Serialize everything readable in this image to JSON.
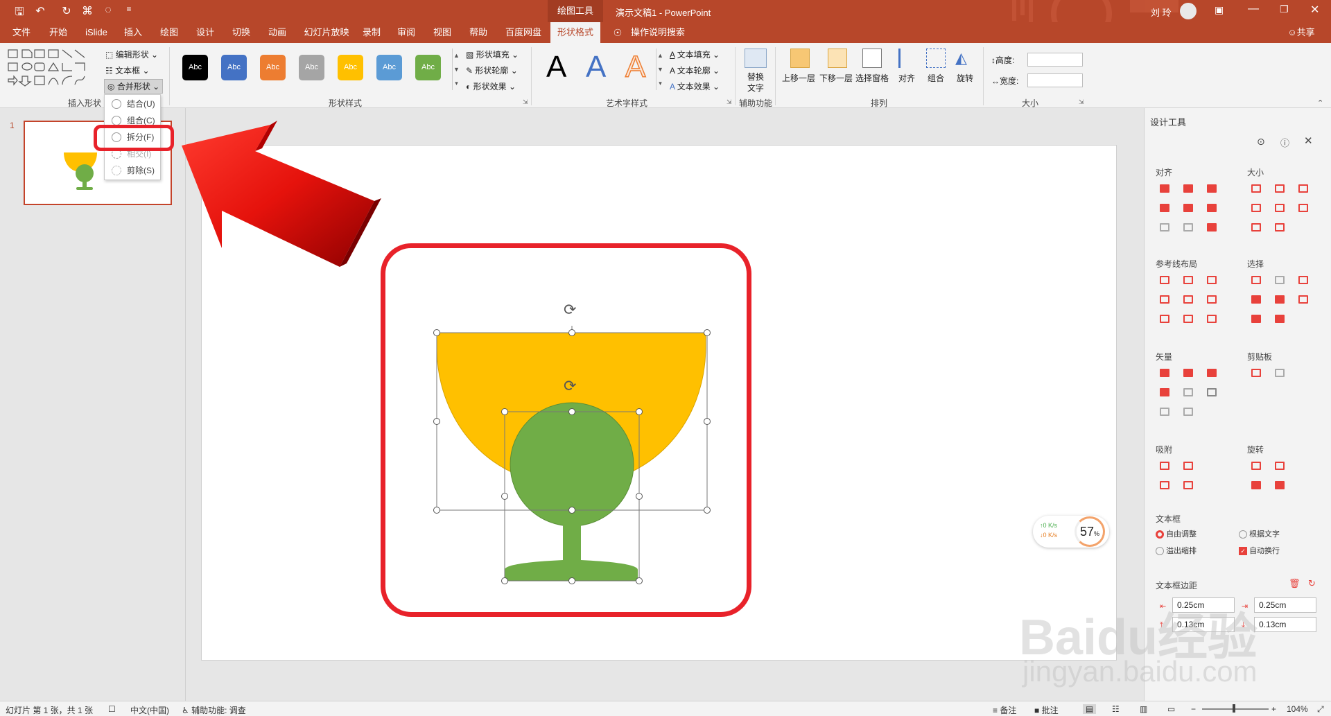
{
  "title_bar": {
    "context_tool": "绘图工具",
    "doc_title": "演示文稿1  -  PowerPoint",
    "user_name": "刘 玲",
    "quick_access": [
      "save-icon",
      "undo-icon",
      "redo-icon",
      "format-painter-icon",
      "shapes-icon",
      "customize-icon"
    ]
  },
  "tabs": [
    "文件",
    "开始",
    "iSlide",
    "插入",
    "绘图",
    "设计",
    "切换",
    "动画",
    "幻灯片放映",
    "录制",
    "审阅",
    "视图",
    "帮助",
    "百度网盘",
    "形状格式"
  ],
  "active_tab": "形状格式",
  "tell_me": "操作说明搜索",
  "share": "共享",
  "ribbon": {
    "insert_shapes": {
      "edit_shape": "编辑形状",
      "text_box": "文本框",
      "merge_shapes": "合并形状",
      "label": "插入形状"
    },
    "shape_styles": {
      "swatches": [
        {
          "text": "Abc",
          "color": "#000000"
        },
        {
          "text": "Abc",
          "color": "#4472c4"
        },
        {
          "text": "Abc",
          "color": "#ed7d31"
        },
        {
          "text": "Abc",
          "color": "#a5a5a5"
        },
        {
          "text": "Abc",
          "color": "#ffc000"
        },
        {
          "text": "Abc",
          "color": "#5b9bd5"
        },
        {
          "text": "Abc",
          "color": "#70ad47"
        }
      ],
      "fill": "形状填充",
      "outline": "形状轮廓",
      "effects": "形状效果",
      "label": "形状样式"
    },
    "wordart": {
      "letters": [
        "A",
        "A",
        "A"
      ],
      "text_fill": "文本填充",
      "text_outline": "文本轮廓",
      "text_effects": "文本效果",
      "label": "艺术字样式"
    },
    "accessibility": {
      "alt_text_l1": "替换",
      "alt_text_l2": "文字",
      "label": "辅助功能"
    },
    "arrange": {
      "bring_forward": "上移一层",
      "send_backward": "下移一层",
      "selection_pane": "选择窗格",
      "align": "对齐",
      "group": "组合",
      "rotate": "旋转",
      "label": "排列"
    },
    "size": {
      "height_label": "高度:",
      "width_label": "宽度:",
      "height_value": "",
      "width_value": "",
      "label": "大小"
    }
  },
  "merge_menu": [
    {
      "label": "结合(U)",
      "disabled": false
    },
    {
      "label": "组合(C)",
      "disabled": false
    },
    {
      "label": "拆分(F)",
      "disabled": false
    },
    {
      "label": "相交(I)",
      "disabled": true
    },
    {
      "label": "剪除(S)",
      "disabled": false
    }
  ],
  "thumbnail": {
    "number": "1"
  },
  "net_widget": {
    "up": "0  K/s",
    "down": "0  K/s",
    "percent": "57",
    "unit": "%"
  },
  "design_pane": {
    "title": "设计工具",
    "sections": {
      "align": "对齐",
      "size": "大小",
      "guides": "参考线布局",
      "select": "选择",
      "vector": "矢量",
      "clipboard": "剪贴板",
      "snap": "吸附",
      "rotate": "旋转",
      "textbox": "文本框",
      "margins": "文本框边距"
    },
    "textbox_options": [
      {
        "label": "自由调整",
        "checked": true,
        "kind": "radio"
      },
      {
        "label": "根据文字",
        "checked": false,
        "kind": "radio"
      },
      {
        "label": "溢出缩排",
        "checked": false,
        "kind": "radio"
      },
      {
        "label": "自动换行",
        "checked": true,
        "kind": "checkbox"
      }
    ],
    "margins": {
      "left": "0.25cm",
      "right": "0.25cm",
      "top": "0.13cm",
      "bottom": "0.13cm"
    }
  },
  "status_bar": {
    "slide_info": "幻灯片 第 1 张，共 1 张",
    "language": "中文(中国)",
    "accessibility": "辅助功能: 调查",
    "notes": "备注",
    "comments": "批注",
    "zoom": "104%"
  },
  "watermark": {
    "line1": "Baidu经验",
    "line2": "jingyan.baidu.com"
  },
  "colors": {
    "accent": "#b7472a",
    "cup_yellow": "#ffc000",
    "cup_green": "#70ad47",
    "highlight_red": "#e8222a"
  }
}
